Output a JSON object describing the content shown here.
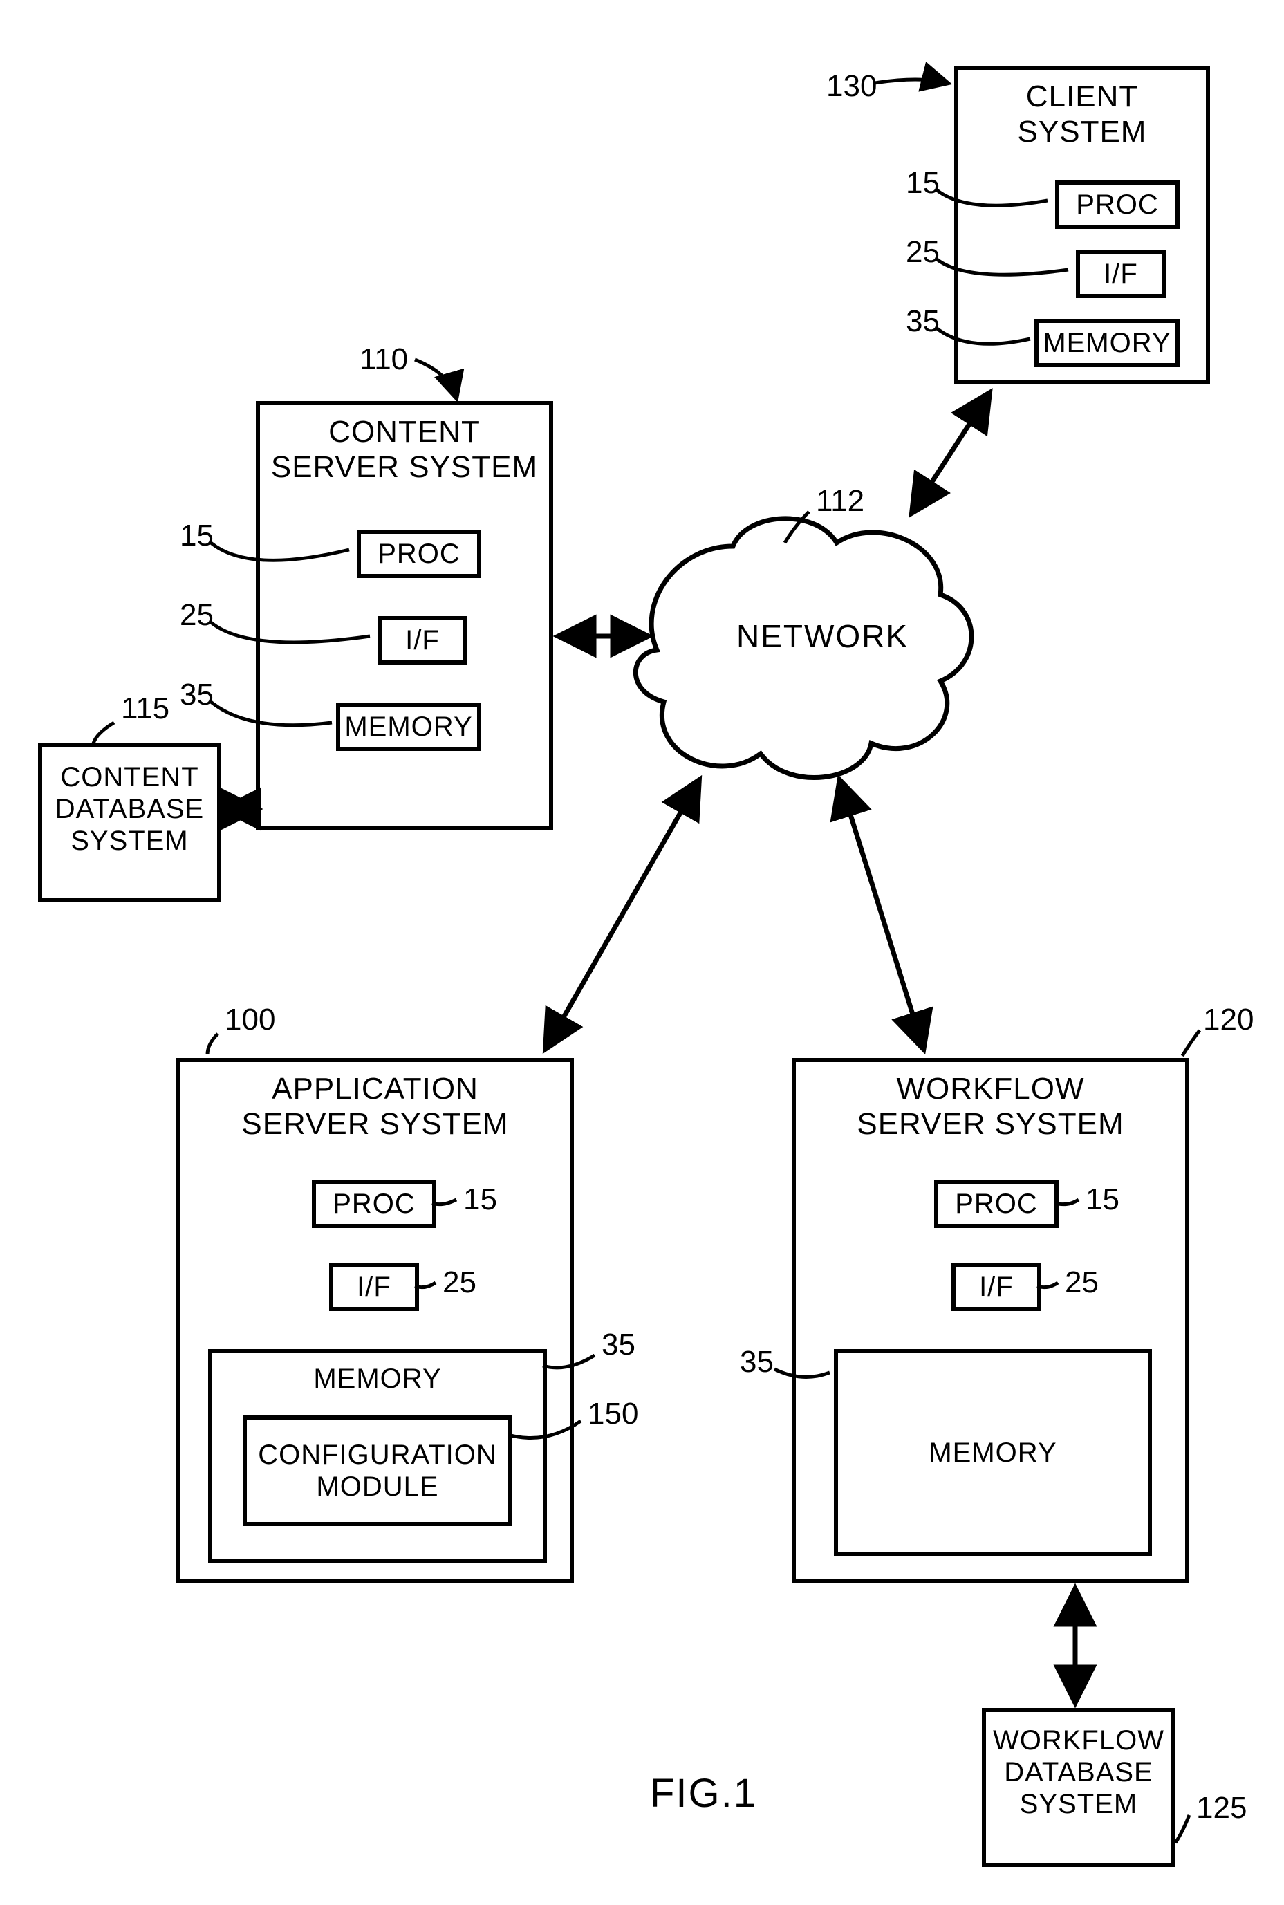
{
  "figure_label": "FIG.1",
  "network": {
    "label": "NETWORK",
    "ref": "112"
  },
  "client": {
    "title": "CLIENT\nSYSTEM",
    "ref": "130",
    "proc": "PROC",
    "proc_ref": "15",
    "if": "I/F",
    "if_ref": "25",
    "mem": "MEMORY",
    "mem_ref": "35"
  },
  "content_server": {
    "title": "CONTENT\nSERVER SYSTEM",
    "ref": "110",
    "proc": "PROC",
    "proc_ref": "15",
    "if": "I/F",
    "if_ref": "25",
    "mem": "MEMORY",
    "mem_ref": "35"
  },
  "content_db": {
    "title": "CONTENT\nDATABASE\nSYSTEM",
    "ref": "115"
  },
  "app_server": {
    "title": "APPLICATION\nSERVER SYSTEM",
    "ref": "100",
    "proc": "PROC",
    "proc_ref": "15",
    "if": "I/F",
    "if_ref": "25",
    "mem": "MEMORY",
    "mem_ref": "35",
    "config": "CONFIGURATION\nMODULE",
    "config_ref": "150"
  },
  "workflow_server": {
    "title": "WORKFLOW\nSERVER SYSTEM",
    "ref": "120",
    "proc": "PROC",
    "proc_ref": "15",
    "if": "I/F",
    "if_ref": "25",
    "mem": "MEMORY",
    "mem_ref": "35"
  },
  "workflow_db": {
    "title": "WORKFLOW\nDATABASE\nSYSTEM",
    "ref": "125"
  }
}
